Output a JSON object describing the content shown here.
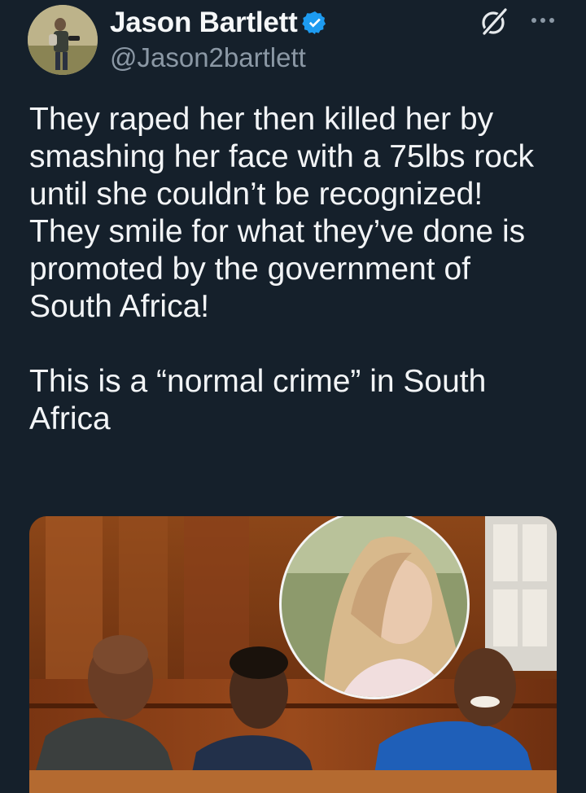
{
  "author": {
    "display_name": "Jason Bartlett",
    "handle": "@Jason2bartlett",
    "verified": true,
    "avatar_icon": "profile-photo"
  },
  "actions": {
    "grok_icon": "grok-icon",
    "more_icon": "more-options-icon"
  },
  "tweet": {
    "paragraph_1": "They raped her then killed her by smashing her face with a 75lbs rock until she couldn’t be recognized! They smile for what they’ve done is promoted by the government of South Africa!",
    "paragraph_2": "This is a “normal crime” in South Africa"
  },
  "media": {
    "type": "photo",
    "description_icon": "courtroom-photo"
  },
  "colors": {
    "background": "#15202b",
    "text_primary": "#f2f4f6",
    "text_secondary": "#8b98a5",
    "verified_badge": "#1d9bf0"
  }
}
